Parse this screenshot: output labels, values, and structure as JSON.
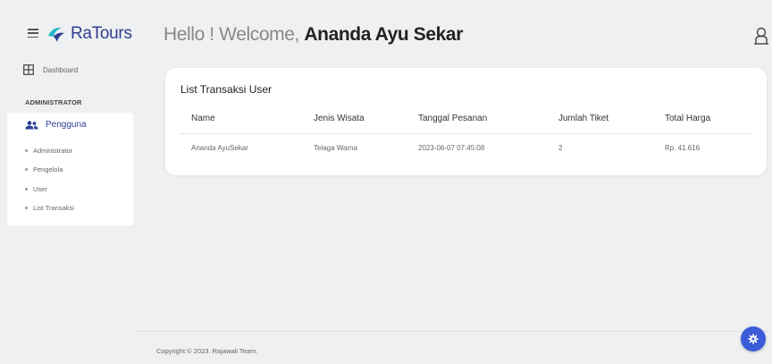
{
  "header": {
    "brand": "RaTours",
    "greeting_prefix": "Hello ! Welcome,",
    "user_name": "Ananda Ayu Sekar"
  },
  "sidebar": {
    "dashboard_label": "Dashboard",
    "section_label": "ADMINISTRATOR",
    "group_label": "Pengguna",
    "sub_items": [
      {
        "label": "Administrator"
      },
      {
        "label": "Pengelola"
      },
      {
        "label": "User"
      },
      {
        "label": "List Transaksi"
      }
    ]
  },
  "main": {
    "card_title": "List Transaksi User",
    "columns": [
      "Name",
      "Jenis Wisata",
      "Tanggal Pesanan",
      "Jumlah Tiket",
      "Total Harga"
    ],
    "rows": [
      [
        "Ananda AyuSekar",
        "Telaga Warna",
        "2023-06-07 07:45:08",
        "2",
        "Rp. 41.616"
      ]
    ]
  },
  "footer": {
    "copyright": "Copyright © 2023. Rajawali Team."
  },
  "colors": {
    "accent": "#2b3f96",
    "settings_button": "#3b5bd9",
    "background": "#eef0f2"
  },
  "icons": {
    "menu": "hamburger-icon",
    "logo": "ratours-logo-icon",
    "user": "user-icon",
    "dashboard": "grid-icon",
    "pengguna": "users-icon",
    "settings": "gear-icon"
  }
}
